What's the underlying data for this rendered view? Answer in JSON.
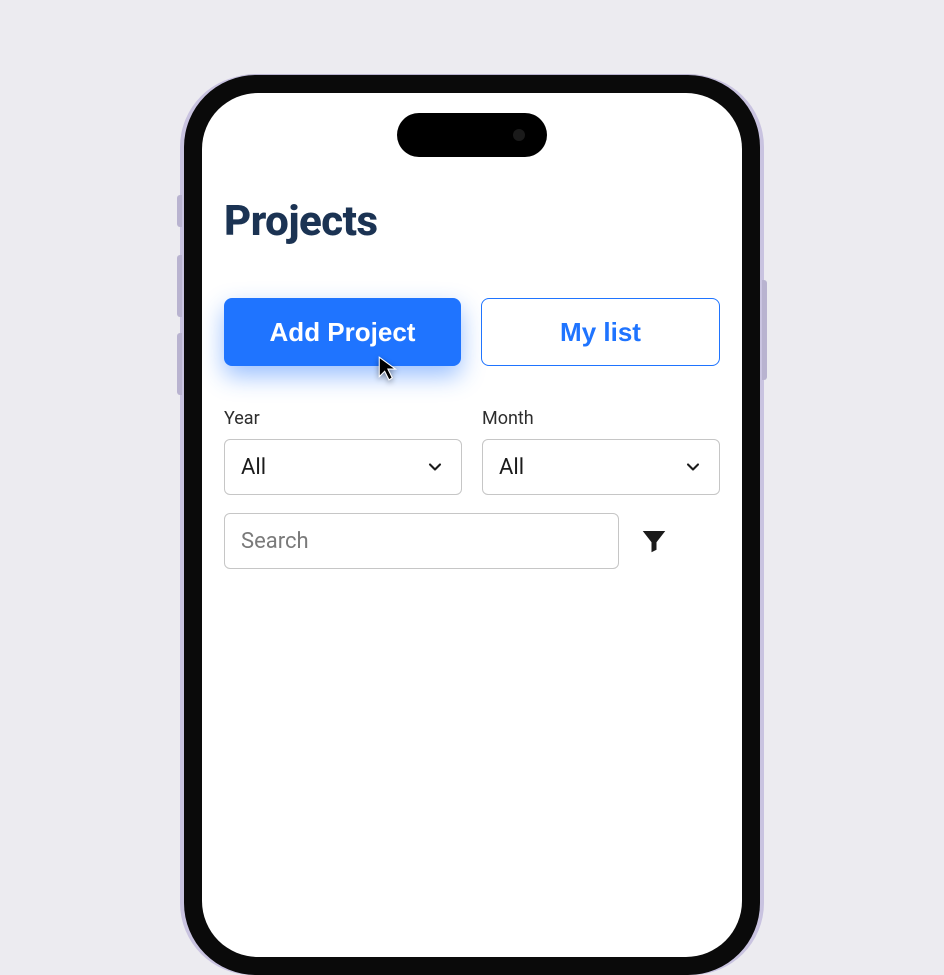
{
  "page": {
    "title": "Projects"
  },
  "actions": {
    "add_project_label": "Add Project",
    "my_list_label": "My list"
  },
  "filters": {
    "year_label": "Year",
    "year_value": "All",
    "month_label": "Month",
    "month_value": "All",
    "search_placeholder": "Search"
  },
  "icons": {
    "chevron_down": "chevron-down-icon",
    "filter": "filter-icon",
    "cursor": "cursor-icon"
  }
}
